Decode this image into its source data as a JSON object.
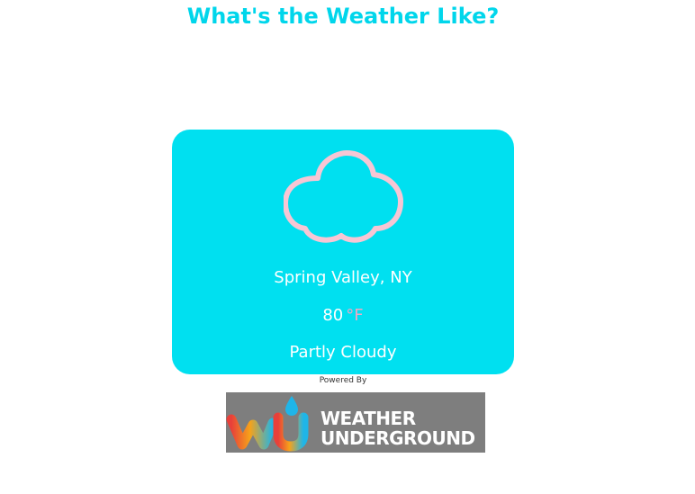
{
  "header": {
    "title": "What's the Weather Like?"
  },
  "weather": {
    "icon": "cloud-icon",
    "location": "Spring Valley, NY",
    "temperature": "80",
    "unit": "°F",
    "condition": "Partly Cloudy"
  },
  "footer": {
    "powered_by": "Powered By",
    "logo": {
      "name": "weather-underground-logo",
      "line1": "WEATHER",
      "line2": "UNDERGROUND"
    }
  },
  "colors": {
    "accent": "#00D6EB",
    "card": "#00E0F0",
    "cloud": "#F7C6D4",
    "logo_bg": "#7E7E7E"
  }
}
